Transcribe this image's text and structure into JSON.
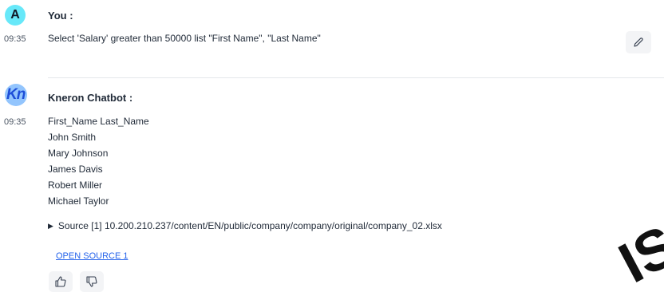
{
  "user_message": {
    "avatar_letter": "A",
    "sender": "You :",
    "time": "09:35",
    "text": "Select 'Salary' greater than 50000 list \"First Name\", \"Last Name\""
  },
  "bot_message": {
    "avatar_text": "Kn",
    "sender": "Kneron Chatbot :",
    "time": "09:35",
    "lines": [
      "First_Name Last_Name",
      "John Smith",
      "Mary Johnson",
      "James Davis",
      "Robert Miller",
      "Michael Taylor"
    ],
    "source_text": "Source [1] 10.200.210.237/content/EN/public/company/company/original/company_02.xlsx",
    "open_source_label": "OPEN SOURCE 1"
  },
  "icons": {
    "edit": "pencil-icon",
    "thumbs_up": "thumbs-up-icon",
    "thumbs_down": "thumbs-down-icon",
    "source_toggle": "triangle-right-icon"
  },
  "watermark": "IS",
  "colors": {
    "user_avatar_bg": "#67e8f9",
    "link": "#2563eb"
  }
}
